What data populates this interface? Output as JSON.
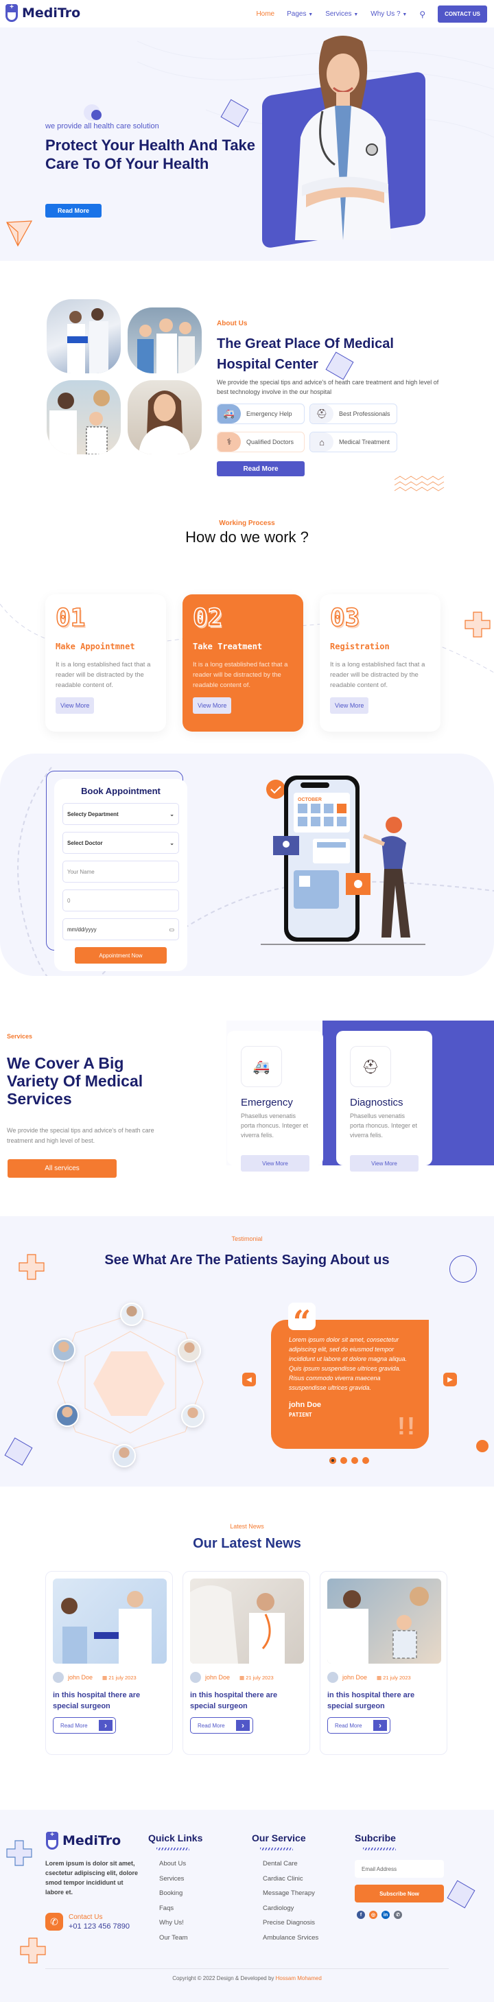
{
  "header": {
    "brand": "MediTro",
    "nav": [
      {
        "label": "Home",
        "active": true
      },
      {
        "label": "Pages",
        "dropdown": true
      },
      {
        "label": "Services",
        "dropdown": true
      },
      {
        "label": "Why Us ?",
        "dropdown": true
      }
    ],
    "search_icon": "search-icon",
    "contact_button": "CONTACT US"
  },
  "hero": {
    "subtitle": "we provide all health care solution",
    "title": "Protect Your Health And Take Care To Of Your Health",
    "button": "Read More"
  },
  "about": {
    "label": "About Us",
    "title": "The Great Place Of Medical Hospital Center",
    "description": "We provide the special tips and advice's of heath care treatment and high level of best technology involve in the our hospital",
    "features": [
      {
        "label": "Emergency Help",
        "icon": "ambulance-icon"
      },
      {
        "label": "Best Professionals",
        "icon": "medical-kit-icon"
      },
      {
        "label": "Qualified Doctors",
        "icon": "stethoscope-icon"
      },
      {
        "label": "Medical Treatment",
        "icon": "clinic-house-icon"
      }
    ],
    "button": "Read More"
  },
  "process": {
    "label": "Working Process",
    "title": "How do we work ?",
    "steps": [
      {
        "number": "01",
        "title": "Make Appointmnet",
        "description": "It is a long established fact that a reader will be distracted by the readable content of.",
        "button": "View More"
      },
      {
        "number": "02",
        "title": "Take Treatment",
        "description": "It is a long established fact that a reader will be distracted by the readable content of.",
        "button": "View More"
      },
      {
        "number": "03",
        "title": "Registration",
        "description": "It is a long established fact that a reader will be distracted by the readable content of.",
        "button": "View More"
      }
    ]
  },
  "booking": {
    "title": "Book Appointment",
    "department_select": "Selecty Department",
    "doctor_select": "Select Doctor",
    "name_placeholder": "Your Name",
    "phone_value": "0",
    "date_placeholder": "mm/dd/yyyy",
    "button": "Appointment Now",
    "illustration_month": "OCTOBER"
  },
  "services": {
    "label": "Services",
    "title": "We Cover A Big Variety Of Medical Services",
    "description": "We provide the special tips and advice's of heath care treatment and high level of best.",
    "button": "All services",
    "cards": [
      {
        "name": "Emergency",
        "description": "Phasellus venenatis porta rhoncus. Integer et viverra felis.",
        "button": "View More",
        "icon": "ambulance-icon"
      },
      {
        "name": "Diagnostics",
        "description": "Phasellus venenatis porta rhoncus. Integer et viverra felis.",
        "button": "View More",
        "icon": "medical-kit-icon"
      }
    ]
  },
  "testimonial": {
    "label": "Testimonial",
    "title": "See What Are The Patients Saying About us",
    "quote": "Lorem ipsum dolor sit amet, consectetur adipiscing elit, sed do eiusmod tempor incididunt ut labore et dolore magna aliqua. Quis ipsum suspendisse ultrices gravida. Risus commodo viverra maecena ssuspendisse ultrices gravida.",
    "name": "john Doe",
    "role": "PATIENT",
    "slide_count": 4,
    "active_slide": 1
  },
  "news": {
    "label": "Latest News",
    "title": "Our Latest News",
    "posts": [
      {
        "author": "john Doe",
        "date": "21 july 2023",
        "headline": "in this hospital there are special surgeon",
        "button": "Read More"
      },
      {
        "author": "john Doe",
        "date": "21 july 2023",
        "headline": "in this hospital there are special surgeon",
        "button": "Read More"
      },
      {
        "author": "john Doe",
        "date": "21 july 2023",
        "headline": "in this hospital there are special surgeon",
        "button": "Read More"
      }
    ]
  },
  "footer": {
    "brand": "MediTro",
    "description": "Lorem ipsum is dolor sit amet, csectetur adipiscing elit, dolore smod tempor incididunt ut labore et.",
    "contact_label": "Contact Us",
    "phone": "+01 123 456 7890",
    "quick_links_title": "Quick Links",
    "quick_links": [
      "About Us",
      "Services",
      "Booking",
      "Faqs",
      "Why Us!",
      "Our Team"
    ],
    "service_title": "Our Service",
    "service_links": [
      "Dental Care",
      "Cardiac Clinic",
      "Message Therapy",
      "Cardiology",
      "Precise Diagnosis",
      "Ambulance Srvices"
    ],
    "subscribe_title": "Subcribe",
    "email_placeholder": "Email Address",
    "subscribe_button": "Subscribe Now",
    "socials": [
      {
        "name": "facebook-icon",
        "glyph": "f",
        "color": "#3b5998"
      },
      {
        "name": "instagram-icon",
        "glyph": "◎",
        "color": "#f47a30"
      },
      {
        "name": "linkedin-icon",
        "glyph": "in",
        "color": "#0a66c2"
      },
      {
        "name": "whatsapp-icon",
        "glyph": "✆",
        "color": "#6b7280"
      }
    ],
    "copyright_prefix": "Copyright © 2022 Design & Developed by",
    "copyright_author": "Hossam Mohamed"
  },
  "colors": {
    "primary": "#5157c8",
    "accent": "#f47a30",
    "heading": "#1b1f6b",
    "hero_button": "#1a73e8"
  }
}
